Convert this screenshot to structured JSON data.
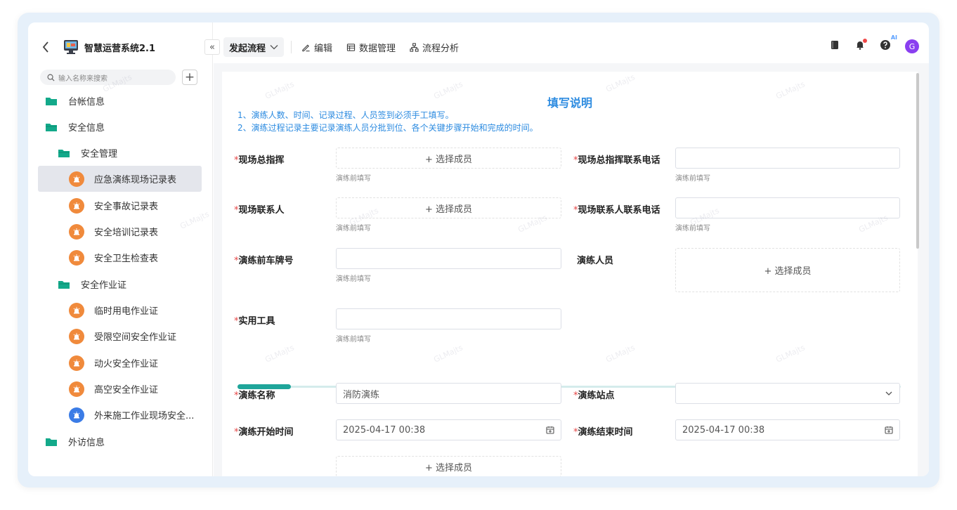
{
  "app": {
    "title": "智慧运营系统2.1"
  },
  "sidebar": {
    "search_placeholder": "输入名称来搜索",
    "add_label": "+",
    "collapse_label": "«",
    "items": [
      {
        "label": "台帐信息",
        "level": 0,
        "type": "folder"
      },
      {
        "label": "安全信息",
        "level": 0,
        "type": "folder-open"
      },
      {
        "label": "安全管理",
        "level": 1,
        "type": "folder-open"
      },
      {
        "label": "应急演练现场记录表",
        "level": 2,
        "type": "form-orange",
        "active": true
      },
      {
        "label": "安全事故记录表",
        "level": 2,
        "type": "form-orange"
      },
      {
        "label": "安全培训记录表",
        "level": 2,
        "type": "form-orange"
      },
      {
        "label": "安全卫生检查表",
        "level": 2,
        "type": "form-orange"
      },
      {
        "label": "安全作业证",
        "level": 1,
        "type": "folder-open"
      },
      {
        "label": "临时用电作业证",
        "level": 2,
        "type": "form-orange"
      },
      {
        "label": "受限空间安全作业证",
        "level": 2,
        "type": "form-orange"
      },
      {
        "label": "动火安全作业证",
        "level": 2,
        "type": "form-orange"
      },
      {
        "label": "高空安全作业证",
        "level": 2,
        "type": "form-orange"
      },
      {
        "label": "外来施工作业现场安全...",
        "level": 2,
        "type": "form-blue"
      },
      {
        "label": "外访信息",
        "level": 0,
        "type": "folder"
      }
    ]
  },
  "toolbar": {
    "start_flow": "发起流程",
    "edit": "编辑",
    "data_manage": "数据管理",
    "flow_analysis": "流程分析",
    "ai_badge": "AI",
    "avatar_letter": "G"
  },
  "form": {
    "instructions_title": "填写说明",
    "instructions": [
      "1、演练人数、时间、记录过程、人员签到必须手工填写。",
      "2、演练过程记录主要记录演练人员分批到位、各个关键步骤开始和完成的时间。"
    ],
    "required_mark": "*",
    "select_member": "+ 选择成员",
    "fields": {
      "commander": {
        "label": "现场总指挥",
        "hint": "演练前填写"
      },
      "commander_phone": {
        "label": "现场总指挥联系电话",
        "hint": "演练前填写",
        "value": ""
      },
      "contact": {
        "label": "现场联系人",
        "hint": "演练前填写"
      },
      "contact_phone": {
        "label": "现场联系人联系电话",
        "hint": "演练前填写",
        "value": ""
      },
      "plate": {
        "label": "演练前车牌号",
        "hint": "演练前填写",
        "value": ""
      },
      "personnel": {
        "label": "演练人员"
      },
      "tools": {
        "label": "实用工具",
        "hint": "演练前填写",
        "value": ""
      },
      "drill_name": {
        "label": "演练名称",
        "value": "消防演练"
      },
      "drill_site": {
        "label": "演练站点",
        "value": ""
      },
      "start_time": {
        "label": "演练开始时间",
        "value": "2025-04-17 00:38"
      },
      "end_time": {
        "label": "演练结束时间",
        "value": "2025-04-17 00:38"
      }
    },
    "progress": 0.08
  },
  "watermark": "GLMajts",
  "colors": {
    "accent": "#2c8be0",
    "teal": "#1fa59a",
    "folder": "#13a98a",
    "form_orange": "#f08a3c",
    "form_blue": "#3b7ce6",
    "required": "#e54545",
    "avatar": "#8a3ff0"
  }
}
